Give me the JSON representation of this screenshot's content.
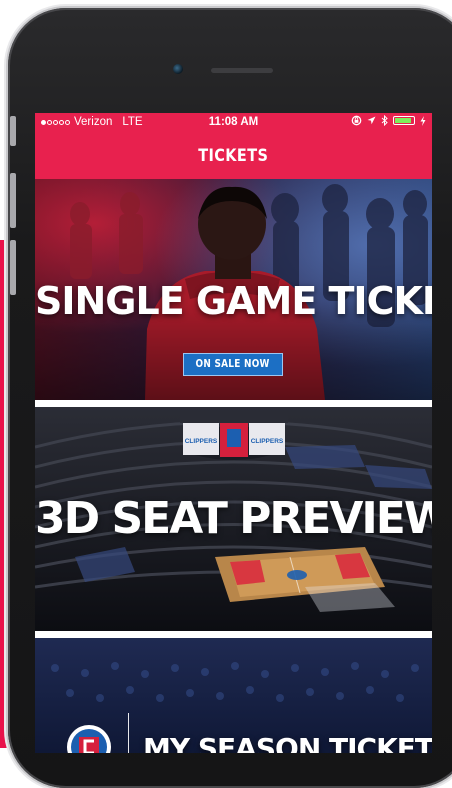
{
  "status_bar": {
    "carrier": "Verizon",
    "network": "LTE",
    "time": "11:08 AM",
    "signal_bars_filled": 1,
    "signal_bars_total": 5,
    "battery_level": 0.9,
    "icons": [
      "lock-rotation-icon",
      "location-arrow-icon",
      "bluetooth-icon",
      "battery-icon",
      "charging-bolt-icon"
    ]
  },
  "header": {
    "title": "TICKETS"
  },
  "tiles": [
    {
      "label": "SINGLE GAME TICKETS",
      "button_label": "ON SALE NOW"
    },
    {
      "label": "3D SEAT PREVIEW",
      "scoreboard_text": "CLIPPERS"
    },
    {
      "label": "MY SEASON TICKETS"
    }
  ],
  "colors": {
    "accent": "#e8214e",
    "button": "#1c6fc4",
    "battery": "#7ef05a"
  }
}
